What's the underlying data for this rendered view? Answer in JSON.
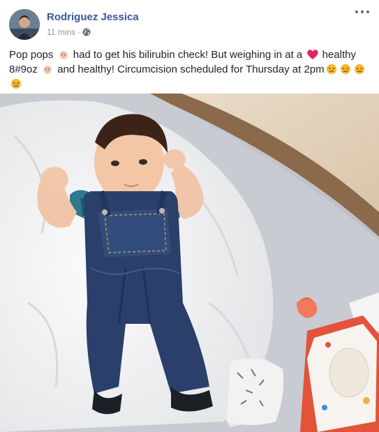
{
  "post": {
    "author": "Rodriguez Jessica",
    "time": "11 mins",
    "separator": "·",
    "privacy_icon": "globe-icon",
    "more_icon": "more-options-icon",
    "text": {
      "part1": "Pop pops",
      "part2": "had to get his bilirubin check! But weighing in at a",
      "part3": "healthy 8#9oz",
      "part4": "and healthy! Circumcision scheduled for Thursday at 2pm"
    },
    "emojis": [
      "baby-emoji",
      "heart-emoji",
      "baby-emoji",
      "crying-face-emoji"
    ]
  },
  "colors": {
    "author": "#385898",
    "meta": "#90949c",
    "text": "#1d2129",
    "heart": "#e0245e",
    "emoji_face": "#f5b82e"
  }
}
